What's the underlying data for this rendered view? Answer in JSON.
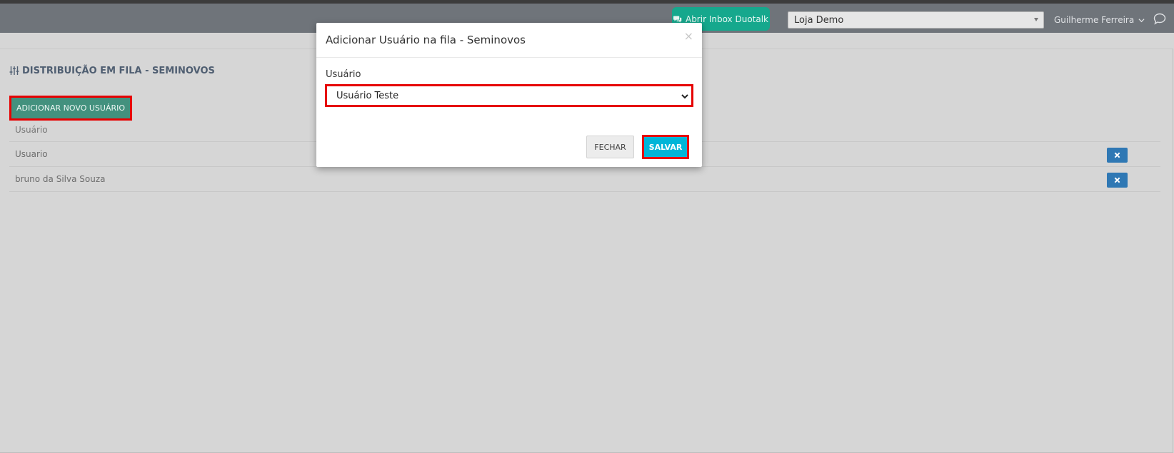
{
  "header": {
    "inbox_button": "Abrir Inbox Duotalk",
    "store": {
      "selected": "Loja Demo"
    },
    "user_name": "Guilherme Ferreira"
  },
  "page": {
    "title": "DISTRIBUIÇÃO EM FILA - SEMINOVOS",
    "add_button": "ADICIONAR NOVO USUÁRIO",
    "table": {
      "header": "Usuário",
      "rows": [
        "Usuario",
        "bruno da Silva Souza"
      ]
    }
  },
  "modal": {
    "title": "Adicionar Usuário na fila - Seminovos",
    "field_label": "Usuário",
    "selected_user": "Usuário Teste",
    "close_button": "FECHAR",
    "save_button": "SALVAR"
  },
  "icons": {
    "inbox": "chat-bubbles-icon",
    "title": "sliders-icon",
    "delete": "times-icon",
    "chat": "chat-bubble-outline-icon",
    "user_chevron": "chevron-down-icon"
  },
  "colors": {
    "accent_teal": "#16a88d",
    "primary_blue": "#2f78b4",
    "save_cyan": "#00b5d8",
    "highlight_red": "#e60000"
  }
}
